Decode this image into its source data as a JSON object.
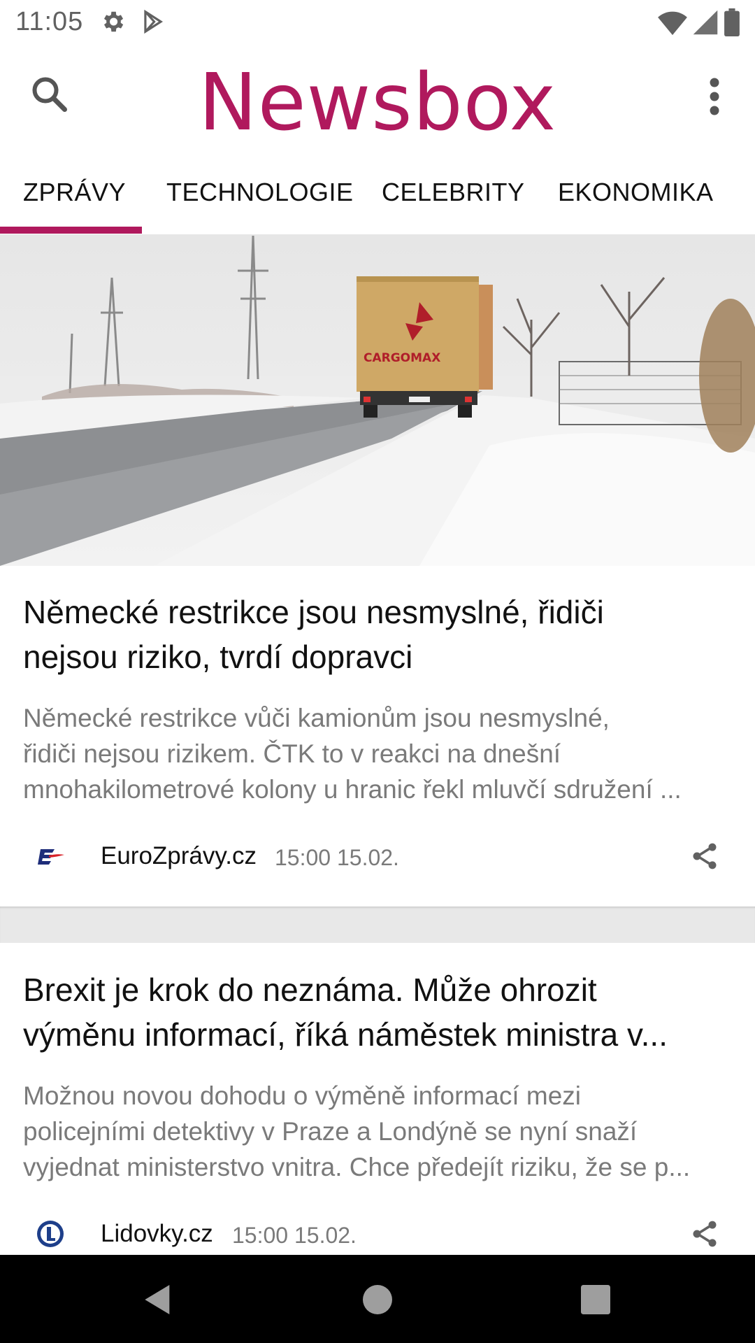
{
  "status_bar": {
    "time": "11:05",
    "icons": [
      "settings-gear-icon",
      "play-store-icon",
      "wifi-icon",
      "signal-icon",
      "battery-icon"
    ]
  },
  "app_bar": {
    "title": "Newsbox",
    "brand_color": "#b0195d",
    "left_icon": "search-icon",
    "right_icon": "more-vert-icon"
  },
  "tabs": [
    {
      "label": "ZPRÁVY",
      "selected": true
    },
    {
      "label": "TECHNOLOGIE",
      "selected": false
    },
    {
      "label": "CELEBRITY",
      "selected": false
    },
    {
      "label": "EKONOMIKA",
      "selected": false
    }
  ],
  "articles": [
    {
      "headline_1": "Německé restrikce jsou nesmyslné, řidiči",
      "headline_2": "nejsou riziko, tvrdí dopravci",
      "summary_1": "Německé restrikce vůči kamionům jsou nesmyslné,",
      "summary_2": "řidiči nejsou rizikem. ČTK to v reakci na dnešní",
      "summary_3": "mnohakilometrové kolony u hranic řekl mluvčí sdružení ...",
      "source": "EuroZprávy.cz",
      "time": "15:00 15.02.",
      "image_label": "CARGOMAX"
    },
    {
      "headline_1": "Brexit je krok do neznáma. Může ohrozit",
      "headline_2": "výměnu informací, říká náměstek ministra v...",
      "summary_1": "Možnou novou dohodu o výměně informací mezi",
      "summary_2": "policejními detektivy v Praze a Londýně se nyní snaží",
      "summary_3": "vyjednat ministerstvo vnitra. Chce předejít riziku, že se p...",
      "source": "Lidovky.cz",
      "time": "15:00 15.02."
    }
  ],
  "nav_bar": {
    "buttons": [
      "back-icon",
      "home-icon",
      "recents-icon"
    ]
  }
}
